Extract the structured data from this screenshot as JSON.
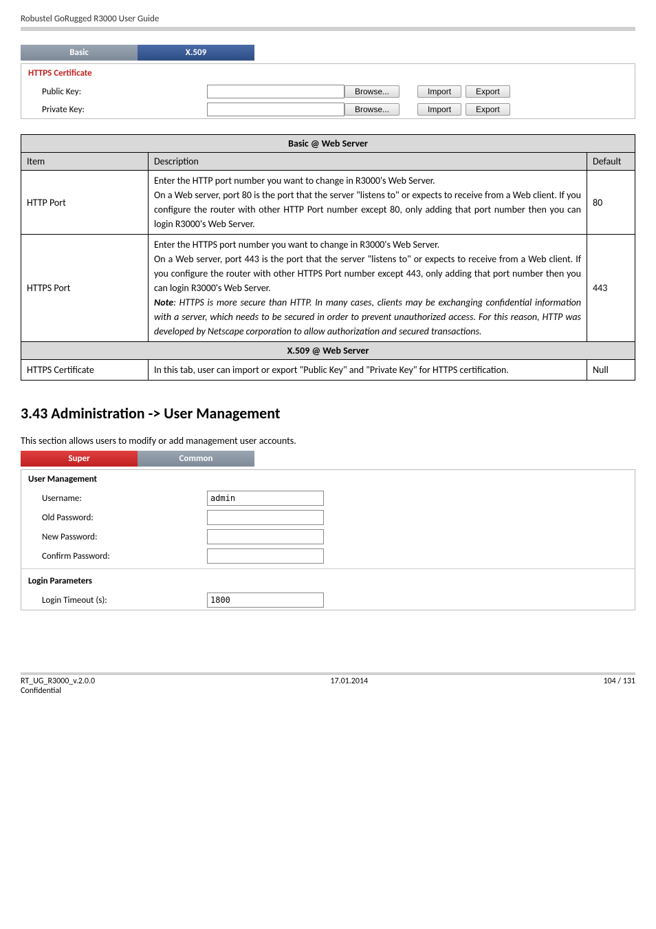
{
  "doc_header": "Robustel GoRugged R3000 User Guide",
  "cert_panel": {
    "tabs": {
      "basic": "Basic",
      "x509": "X.509"
    },
    "title": "HTTPS Certificate",
    "rows": {
      "public": {
        "label": "Public Key:",
        "browse": "Browse...",
        "import": "Import",
        "export": "Export"
      },
      "private": {
        "label": "Private Key:",
        "browse": "Browse...",
        "import": "Import",
        "export": "Export"
      }
    }
  },
  "table1": {
    "header": "Basic @ Web Server",
    "cols": {
      "item": "Item",
      "desc": "Description",
      "default": "Default"
    },
    "rows": [
      {
        "item": "HTTP Port",
        "desc": "Enter the HTTP port number you want to change in R3000's Web Server.\nOn a Web server, port 80 is the port that the server \"listens to\" or expects to receive from a Web client. If you configure the router with other HTTP Port number except 80, only adding that port number then you can login R3000's Web Server.",
        "default": "80"
      },
      {
        "item": "HTTPS Port",
        "desc_plain": "Enter the HTTPS port number you want to change in R3000's Web Server.\nOn a Web server, port 443 is the port that the server \"listens to\" or expects to receive from a Web client. If you configure the router with other HTTPS Port number except 443, only adding that port number then you can login R3000's Web Server.",
        "desc_note_label": "Note",
        "desc_note": ": HTTPS is more secure than HTTP. In many cases, clients may be exchanging confidential information with a server, which needs to be secured in order to prevent unauthorized access. For this reason, HTTP was developed by Netscape corporation to allow authorization and secured transactions.",
        "default": "443"
      }
    ],
    "header2": "X.509 @ Web Server",
    "row3": {
      "item": "HTTPS Certificate",
      "desc": "In this tab, user can import or export \"Public Key\" and \"Private Key\" for HTTPS certification.",
      "default": "Null"
    }
  },
  "section": {
    "title": "3.43  Administration -> User Management",
    "intro": "This section allows users to modify or add management user accounts."
  },
  "um_panel": {
    "tabs": {
      "super": "Super",
      "common": "Common"
    },
    "title1": "User Management",
    "fields": {
      "username": {
        "label": "Username:",
        "value": "admin"
      },
      "old_pw": {
        "label": "Old Password:",
        "value": ""
      },
      "new_pw": {
        "label": "New Password:",
        "value": ""
      },
      "confirm_pw": {
        "label": "Confirm Password:",
        "value": ""
      }
    },
    "title2": "Login Parameters",
    "timeout": {
      "label": "Login Timeout (s):",
      "value": "1800"
    }
  },
  "footer": {
    "left1": "RT_UG_R3000_v.2.0.0",
    "left2": "Confidential",
    "center": "17.01.2014",
    "right": "104 / 131"
  }
}
